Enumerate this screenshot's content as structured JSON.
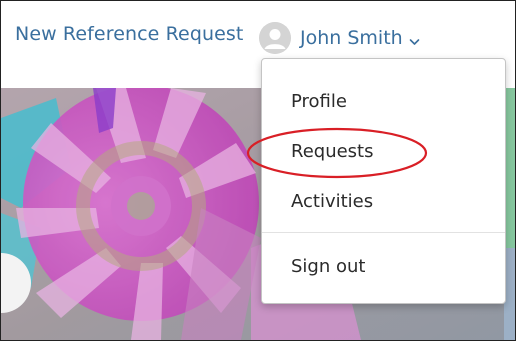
{
  "header": {
    "new_request_link": "New Reference Request",
    "user_name": "John Smith"
  },
  "user_menu": {
    "items": [
      {
        "label": "Profile"
      },
      {
        "label": "Requests"
      },
      {
        "label": "Activities"
      },
      {
        "label": "Sign out"
      }
    ]
  },
  "colors": {
    "link": "#3a6f9e",
    "annotation_ring": "#d91f26",
    "menu_text": "#2b2b2b"
  },
  "icons": {
    "avatar": "user-avatar-icon",
    "dropdown": "chevron-down-icon"
  }
}
